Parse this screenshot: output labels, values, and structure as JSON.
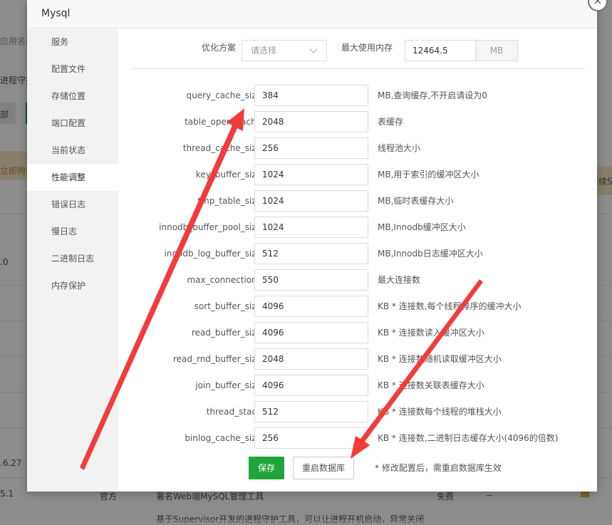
{
  "background": {
    "left_texts": [
      "应用名称",
      "进程守护",
      "部",
      "立即购",
      ".0",
      ".6.27",
      "5.1"
    ],
    "bottom_texts": [
      "官方",
      "著名Web端MySQL管理工具",
      "免费",
      "--",
      "基于Supervisor开发的进程守护工具，可以让进程开机启动，异常关闭"
    ],
    "right_text": "续SS"
  },
  "modal": {
    "title": "Mysql",
    "close_glyph": "×"
  },
  "sidebar": {
    "items": [
      {
        "label": "服务"
      },
      {
        "label": "配置文件"
      },
      {
        "label": "存储位置"
      },
      {
        "label": "端口配置"
      },
      {
        "label": "当前状态"
      },
      {
        "label": "性能调整"
      },
      {
        "label": "错误日志"
      },
      {
        "label": "慢日志"
      },
      {
        "label": "二进制日志"
      },
      {
        "label": "内存保护"
      }
    ],
    "active_index": 5
  },
  "optimize": {
    "label": "优化方案",
    "placeholder": "请选择",
    "max_mem_label": "最大使用内存",
    "max_mem_value": "12464.5",
    "unit": "MB"
  },
  "params": [
    {
      "key": "query_cache_size",
      "value": "384",
      "desc": "MB,查询缓存,不开启请设为0"
    },
    {
      "key": "table_open_cache",
      "value": "2048",
      "desc": "表缓存"
    },
    {
      "key": "thread_cache_size",
      "value": "256",
      "desc": "线程池大小"
    },
    {
      "key": "key_buffer_size",
      "value": "1024",
      "desc": "MB,用于索引的缓冲区大小"
    },
    {
      "key": "tmp_table_size",
      "value": "1024",
      "desc": "MB,临时表缓存大小"
    },
    {
      "key": "innodb_buffer_pool_size",
      "value": "1024",
      "desc": "MB,Innodb缓冲区大小"
    },
    {
      "key": "innodb_log_buffer_size",
      "value": "512",
      "desc": "MB,Innodb日志缓冲区大小"
    },
    {
      "key": "max_connections",
      "value": "550",
      "desc": "最大连接数"
    },
    {
      "key": "sort_buffer_size",
      "value": "4096",
      "desc": "KB * 连接数,每个线程排序的缓冲大小"
    },
    {
      "key": "read_buffer_size",
      "value": "4096",
      "desc": "KB * 连接数读入缓冲区大小"
    },
    {
      "key": "read_rnd_buffer_size",
      "value": "2048",
      "desc": "KB * 连接数随机读取缓冲区大小"
    },
    {
      "key": "join_buffer_size",
      "value": "4096",
      "desc": "KB * 连接数关联表缓存大小"
    },
    {
      "key": "thread_stack",
      "value": "512",
      "desc": "KB * 连接数每个线程的堆栈大小"
    },
    {
      "key": "binlog_cache_size",
      "value": "256",
      "desc": "KB * 连接数,二进制日志缓存大小(4096的倍数)"
    }
  ],
  "actions": {
    "save_label": "保存",
    "restart_label": "重启数据库",
    "note": "* 修改配置后，需重启数据库生效"
  },
  "colors": {
    "primary_green": "#20a53a",
    "annotation_red": "#f23b3b"
  }
}
